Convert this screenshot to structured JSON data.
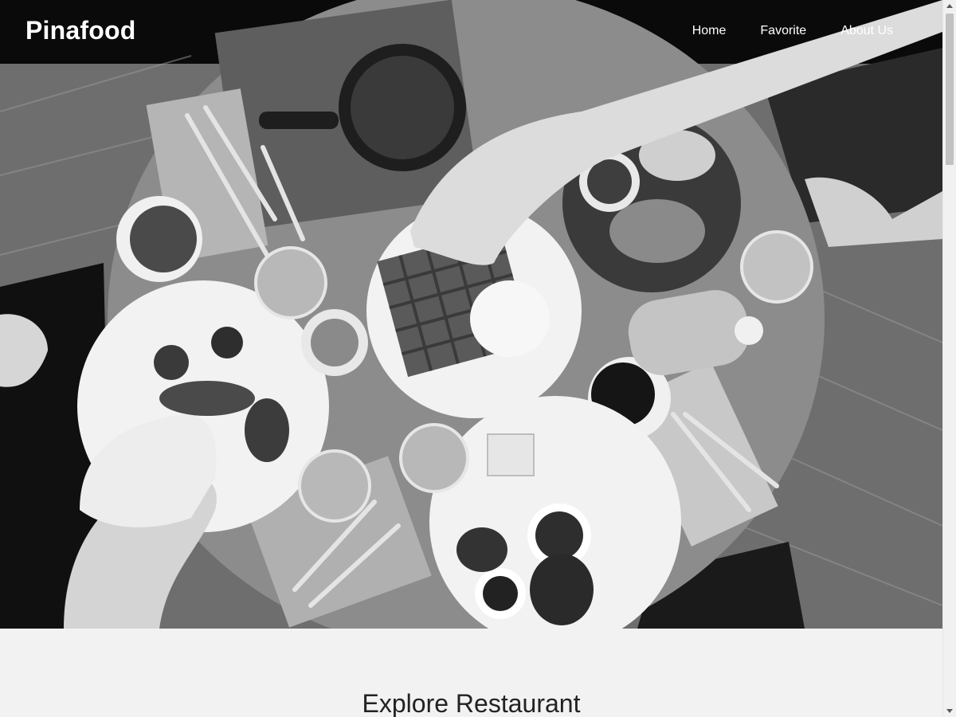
{
  "brand": "Pinafood",
  "nav": {
    "home": "Home",
    "favorite": "Favorite",
    "about": "About Us"
  },
  "hero": {
    "image": "breakfast-table-photo"
  },
  "explore": {
    "title": "Explore Restaurant"
  },
  "colors": {
    "page_background": "#f2f2f2",
    "nav_text": "#ffffff",
    "heading_text": "#222222"
  }
}
